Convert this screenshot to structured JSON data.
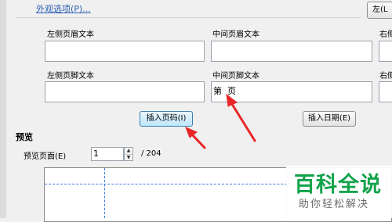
{
  "top_link": "外观选项(P)...",
  "top_right_button": "左(L",
  "header_section": {
    "left_label": "左侧页眉文本",
    "center_label": "中间页眉文本",
    "right_label": "右侧"
  },
  "footer_section": {
    "left_label": "左侧页脚文本",
    "center_label": "中间页脚文本",
    "right_label": "右侧",
    "center_value": "第  页"
  },
  "buttons": {
    "insert_page": "插入页码(I)",
    "insert_date": "插入日期(E)"
  },
  "preview": {
    "title": "预览",
    "page_label": "预览页面(E)",
    "page_value": "1",
    "page_total": "/ 204"
  },
  "watermark": {
    "title": "百科全说",
    "subtitle": "助你轻松解决"
  },
  "colors": {
    "arrow": "#e8262a",
    "guide": "#3a7bd5",
    "watermark": "#12a34a"
  }
}
